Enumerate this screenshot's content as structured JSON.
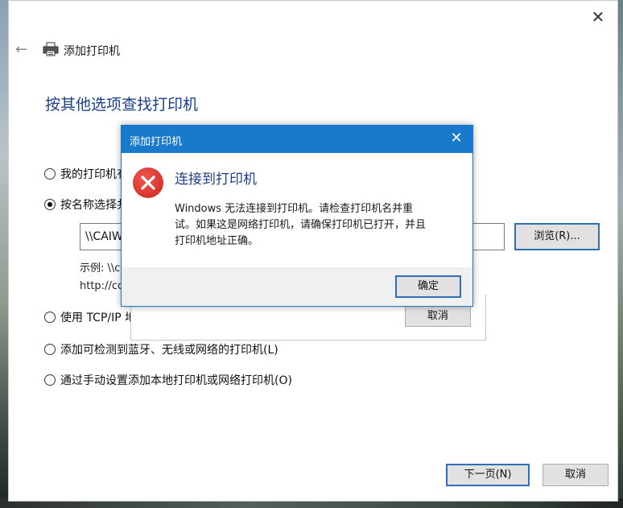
{
  "window": {
    "title": "添加打印机",
    "heading": "按其他选项查找打印机",
    "close_glyph": "✕",
    "back_glyph": "←"
  },
  "options": [
    {
      "label": "我的打印机有",
      "checked": false
    },
    {
      "label": "按名称选择共",
      "checked": true
    },
    {
      "label": "使用 TCP/IP 地",
      "checked": false
    },
    {
      "label": "添加可检测到蓝牙、无线或网络的打印机(L)",
      "checked": false
    },
    {
      "label": "通过手动设置添加本地打印机或网络打印机(O)",
      "checked": false
    }
  ],
  "name_input": {
    "value": "\\\\CAIWU"
  },
  "browse_label": "浏览(R)...",
  "example": {
    "line1": "示例: \\\\c",
    "line2": "http://co"
  },
  "behind_cancel_label": "取消",
  "footer": {
    "next_label": "下一页(N)",
    "cancel_label": "取消"
  },
  "dialog": {
    "title": "添加打印机",
    "close_glyph": "✕",
    "heading": "连接到打印机",
    "message_lines": [
      "Windows 无法连接到打印机。请检查打印机名并重",
      "试。如果这是网络打印机，请确保打印机已打开，并且",
      "打印机地址正确。"
    ],
    "ok_label": "确定"
  },
  "colors": {
    "accent": "#1979ca",
    "heading": "#1c3f8c",
    "error": "#d9342b"
  },
  "icons": [
    "printer-icon",
    "error-icon",
    "close-icon",
    "back-arrow-icon"
  ]
}
